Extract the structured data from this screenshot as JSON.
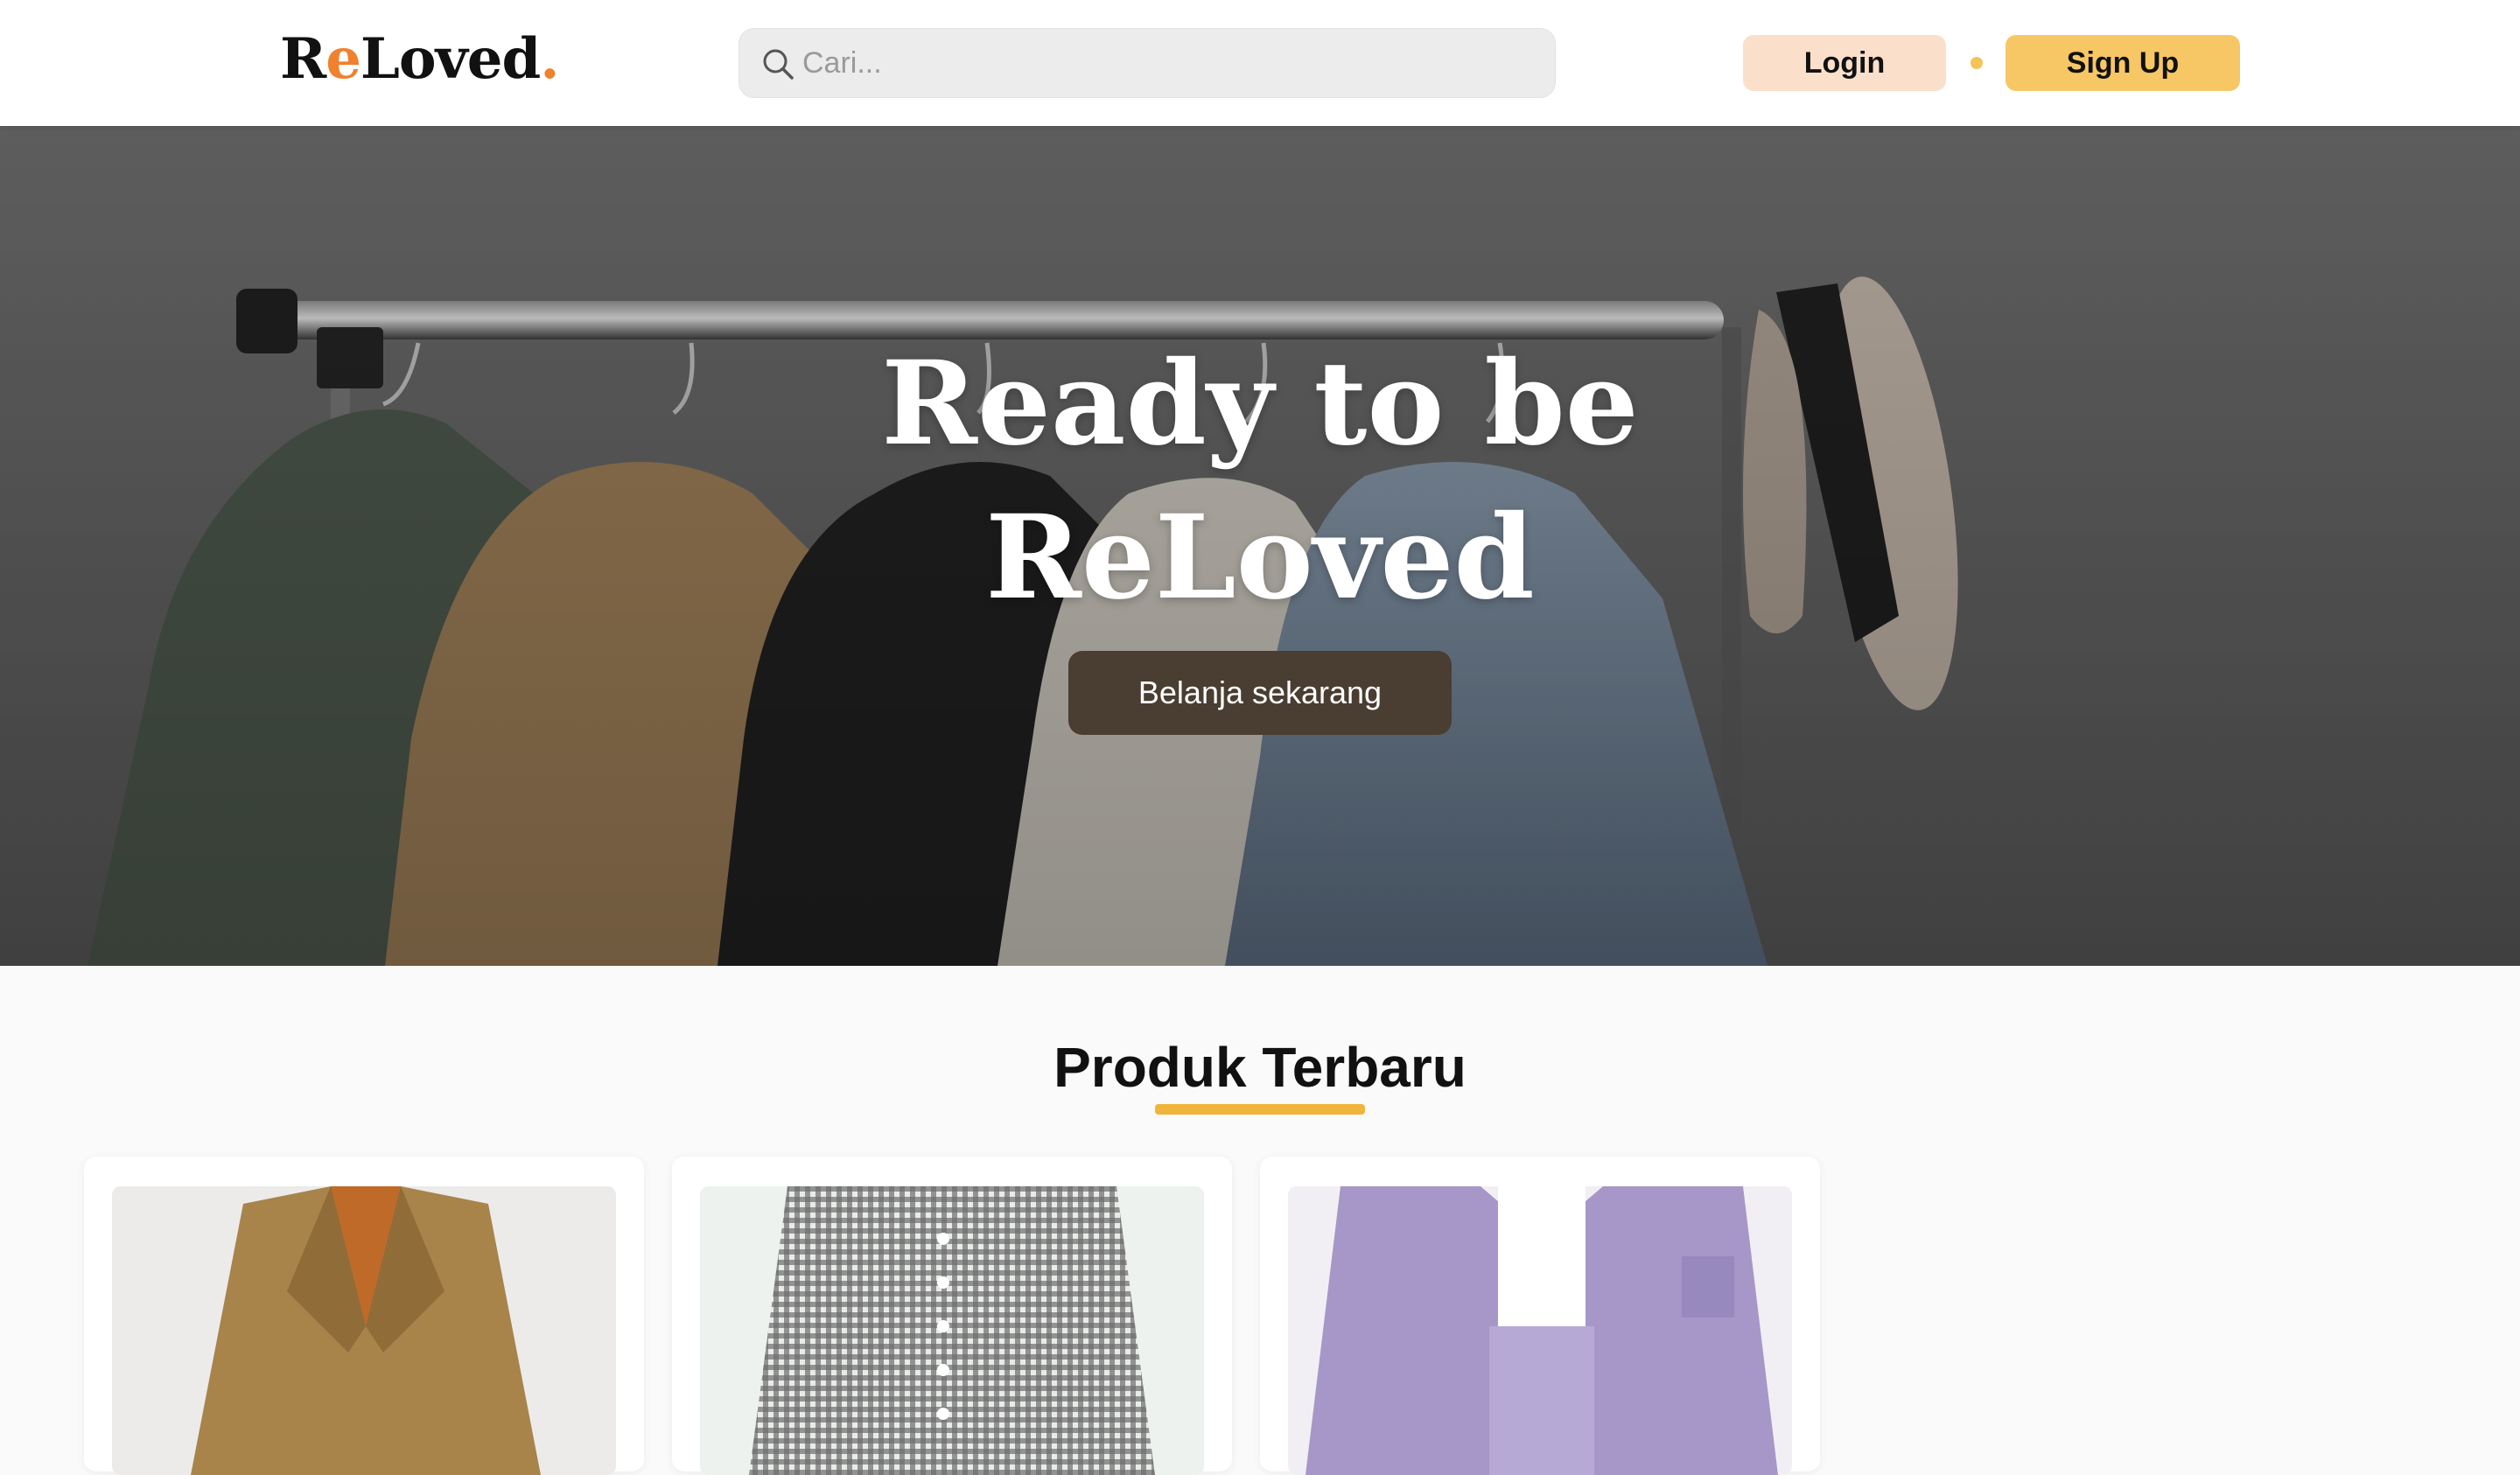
{
  "header": {
    "logo": {
      "part1": "R",
      "accent": "e",
      "part2": "Loved",
      "dot": "."
    },
    "search": {
      "placeholder": "Cari...",
      "value": ""
    },
    "login_label": "Login",
    "signup_label": "Sign Up"
  },
  "hero": {
    "title_line1": "Ready to be",
    "title_line2": "ReLoved",
    "cta_label": "Belanja sekarang"
  },
  "products": {
    "title": "Produk Terbaru",
    "items": [
      {
        "image": "brown-blazer"
      },
      {
        "image": "gingham-skirt"
      },
      {
        "image": "lilac-shirt-set"
      }
    ]
  },
  "colors": {
    "brand_accent": "#f0812f",
    "login_bg": "#fae0cb",
    "signup_bg": "#f7c765",
    "cta_bg": "#4a3d31",
    "underline": "#f0b43a"
  }
}
